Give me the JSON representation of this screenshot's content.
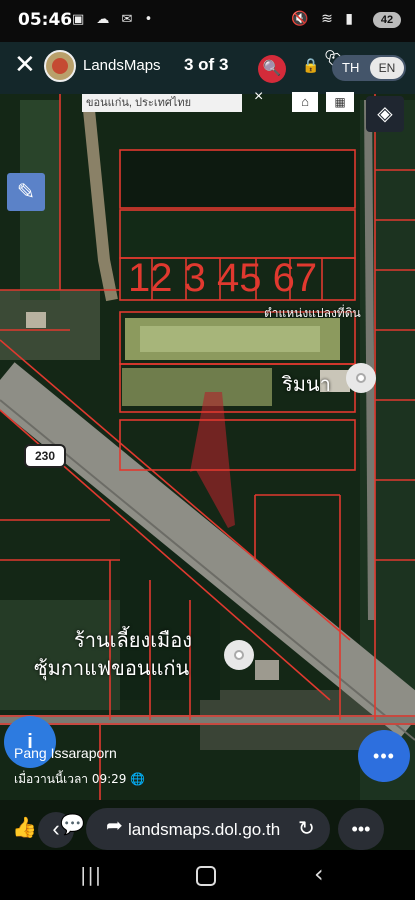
{
  "status_bar": {
    "time": "05:46",
    "left_icons": "▣ ☁ ✉ •",
    "right_icons": "🔇 ≋ ▮",
    "battery": "42"
  },
  "header": {
    "app_title": "LandsMaps",
    "counter": "3 of 3",
    "lang_th": "TH",
    "lang_en": "EN"
  },
  "map": {
    "search_value": "ขอนแก่น, ประเทศไทย",
    "clear_label": "×",
    "parcel_numbers": "12 3 45 67",
    "position_label": "ตำแหน่งแปลงที่ดิน",
    "place_name_1": "ริมนา",
    "place_name_2_line1": "ร้านเลี้ยงเมือง",
    "place_name_2_line2": "ซุ้มกาแฟขอนแก่น",
    "road_number": "230",
    "icons": {
      "close": "close-icon",
      "search": "search-icon",
      "lock": "lock-icon",
      "tag": "tag-icon",
      "layers": "layers-icon",
      "pencil": "pencil-icon",
      "grid": "grid-icon",
      "info": "info-icon"
    }
  },
  "post": {
    "author": "Pang Issaraporn",
    "time": "เมื่อวานนี้เวลา 09:29 🌐"
  },
  "bottom_bar": {
    "url": "landsmaps.dol.go.th",
    "more": "•••"
  },
  "colors": {
    "parcel_line": "#e0392f",
    "accent_blue": "#2d7be0",
    "search_red": "#d42b3a"
  }
}
